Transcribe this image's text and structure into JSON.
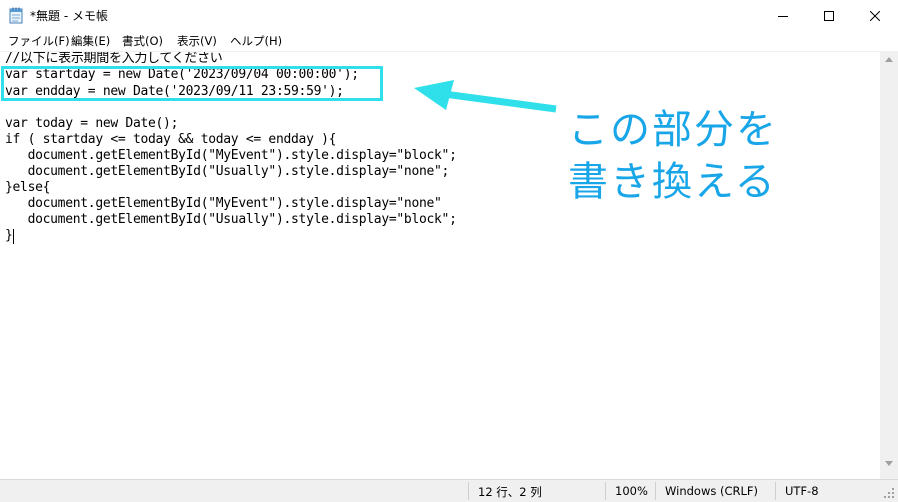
{
  "window": {
    "title": "*無題 - メモ帳",
    "controls": [
      "minimize",
      "maximize",
      "close"
    ]
  },
  "menu": {
    "items": [
      {
        "label": "ファイル(F)"
      },
      {
        "label": "編集(E)"
      },
      {
        "label": "書式(O)"
      },
      {
        "label": "表示(V)"
      },
      {
        "label": "ヘルプ(H)"
      }
    ]
  },
  "editor": {
    "lines": [
      "//以下に表示期間を入力してください",
      "var startday = new Date('2023/09/04 00:00:00');",
      "var endday = new Date('2023/09/11 23:59:59');",
      "",
      "var today = new Date();",
      "if ( startday <= today && today <= endday ){",
      "   document.getElementById(\"MyEvent\").style.display=\"block\";",
      "   document.getElementById(\"Usually\").style.display=\"none\";",
      "}else{",
      "   document.getElementById(\"MyEvent\").style.display=\"none\"",
      "   document.getElementById(\"Usually\").style.display=\"block\";",
      "}"
    ]
  },
  "statusbar": {
    "position": "12 行、2 列",
    "zoom": "100%",
    "line_ending": "Windows (CRLF)",
    "encoding": "UTF-8"
  },
  "annotation": {
    "line1": "この部分を",
    "line2": "書き換える",
    "color": "#18a6e8",
    "box_color": "#2fe0ea"
  }
}
